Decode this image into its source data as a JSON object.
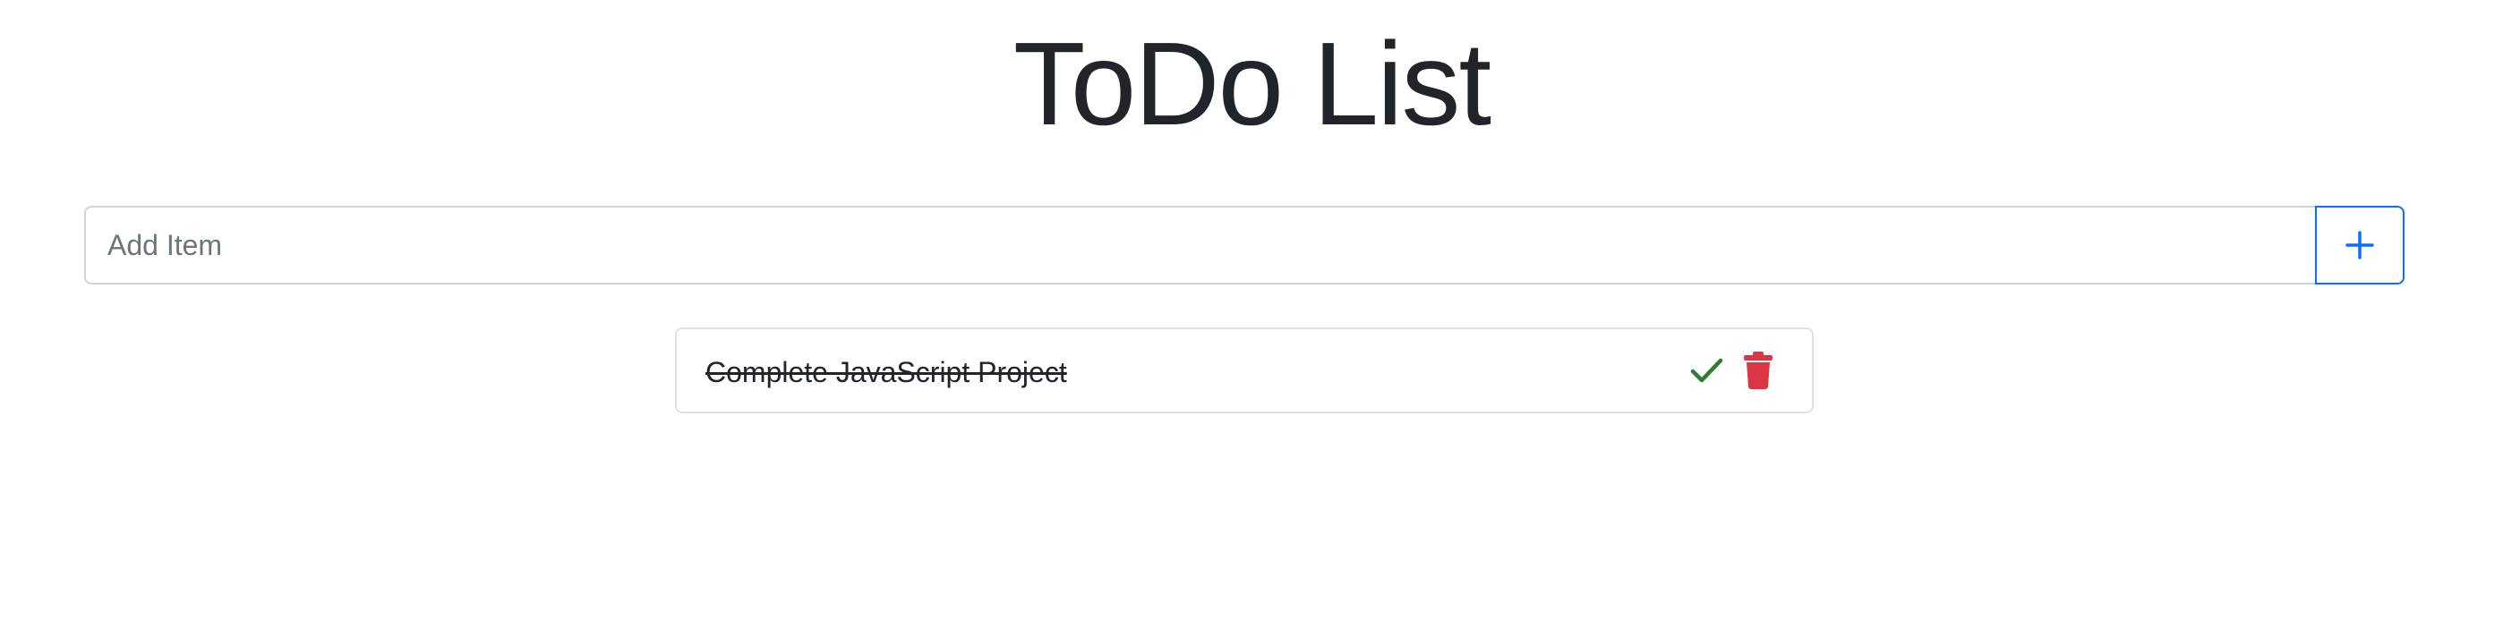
{
  "header": {
    "title": "ToDo List"
  },
  "add_form": {
    "placeholder": "Add Item",
    "value": "",
    "add_button_icon": "plus-icon",
    "accent_color": "#0d6efd"
  },
  "todo_items": [
    {
      "text": "Complete JavaScript Project",
      "completed": true,
      "complete_icon": "check-icon",
      "complete_icon_color": "#2e7d32",
      "delete_icon": "trash-icon",
      "delete_icon_color": "#dc3545"
    }
  ]
}
